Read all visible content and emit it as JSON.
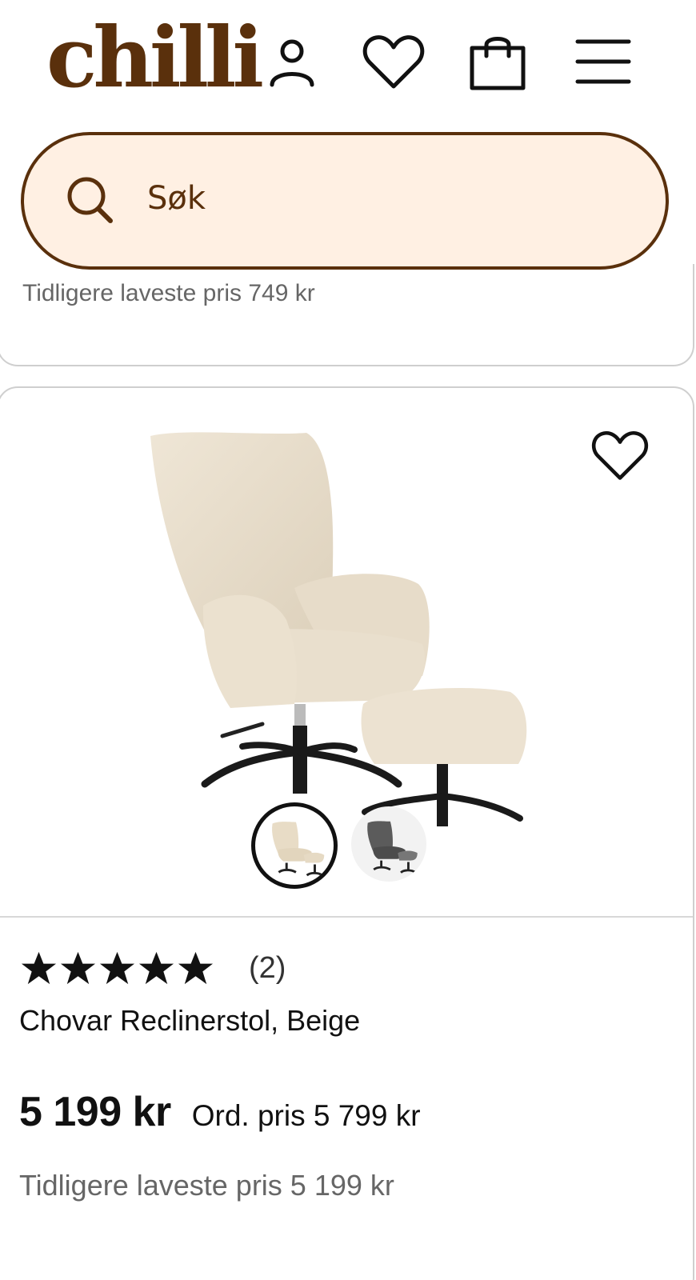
{
  "header": {
    "logo": "chilli",
    "icons": [
      "user-icon",
      "heart-icon",
      "bag-icon",
      "menu-icon"
    ]
  },
  "search": {
    "placeholder": "Søk"
  },
  "previous_card": {
    "lowest_price_text": "Tidligere laveste pris 749 kr"
  },
  "product": {
    "name": "Chovar Reclinerstol, Beige",
    "rating": {
      "stars": 5,
      "max": 5,
      "count": "(2)"
    },
    "price": "5 199 kr",
    "ordinary_price": "Ord. pris 5 799 kr",
    "lowest_price": "Tidligere laveste pris 5 199 kr",
    "variants": [
      {
        "color": "beige",
        "selected": true
      },
      {
        "color": "grey",
        "selected": false
      }
    ]
  },
  "colors": {
    "brand": "#5a300c",
    "search_bg": "#fff0e3",
    "text": "#111111",
    "muted": "#666666",
    "border": "#cfcfcf"
  }
}
